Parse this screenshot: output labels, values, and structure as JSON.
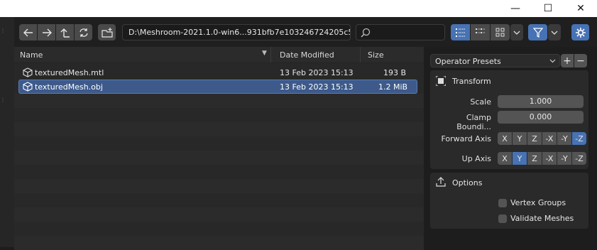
{
  "window": {
    "minimize_glyph": "—",
    "maximize_glyph": "☐",
    "close_glyph": "✕"
  },
  "toolbar": {
    "path": "D:\\Meshroom-2021.1.0-win6...931bfb7e103246724205c5\\",
    "search_value": "",
    "icons": [
      "back-icon",
      "forward-icon",
      "parent-dir-icon",
      "refresh-icon",
      "new-folder-icon",
      "search-icon",
      "vertical-list-icon",
      "horizontal-list-icon",
      "thumbnails-icon",
      "chevron-down-icon",
      "filter-icon",
      "chevron-down-icon",
      "gear-icon"
    ]
  },
  "filelist": {
    "columns": {
      "name": "Name",
      "date": "Date Modified",
      "size": "Size"
    },
    "files": [
      {
        "name": "texturedMesh.mtl",
        "date": "13 Feb 2023 15:13",
        "size": "193 B",
        "icon": "mesh-cube-icon"
      },
      {
        "name": "texturedMesh.obj",
        "date": "13 Feb 2023 15:13",
        "size": "1.2 MiB",
        "icon": "mesh-cube-icon",
        "selected": true
      }
    ]
  },
  "panel": {
    "operator_presets": "Operator Presets",
    "add": "+",
    "remove": "−",
    "transform": {
      "title": "Transform",
      "scale_label": "Scale",
      "scale_value": "1.000",
      "clamp_label": "Clamp Boundi...",
      "clamp_value": "0.000",
      "forward_label": "Forward Axis",
      "up_label": "Up Axis",
      "axes": [
        "X",
        "Y",
        "Z",
        "-X",
        "-Y",
        "-Z"
      ],
      "forward_selected": "-Z",
      "up_selected": "Y"
    },
    "options": {
      "title": "Options",
      "vertex_groups": "Vertex Groups",
      "validate_meshes": "Validate Meshes"
    }
  },
  "colors": {
    "accent": "#4772b3",
    "selected_row": "#3d5a8a"
  }
}
